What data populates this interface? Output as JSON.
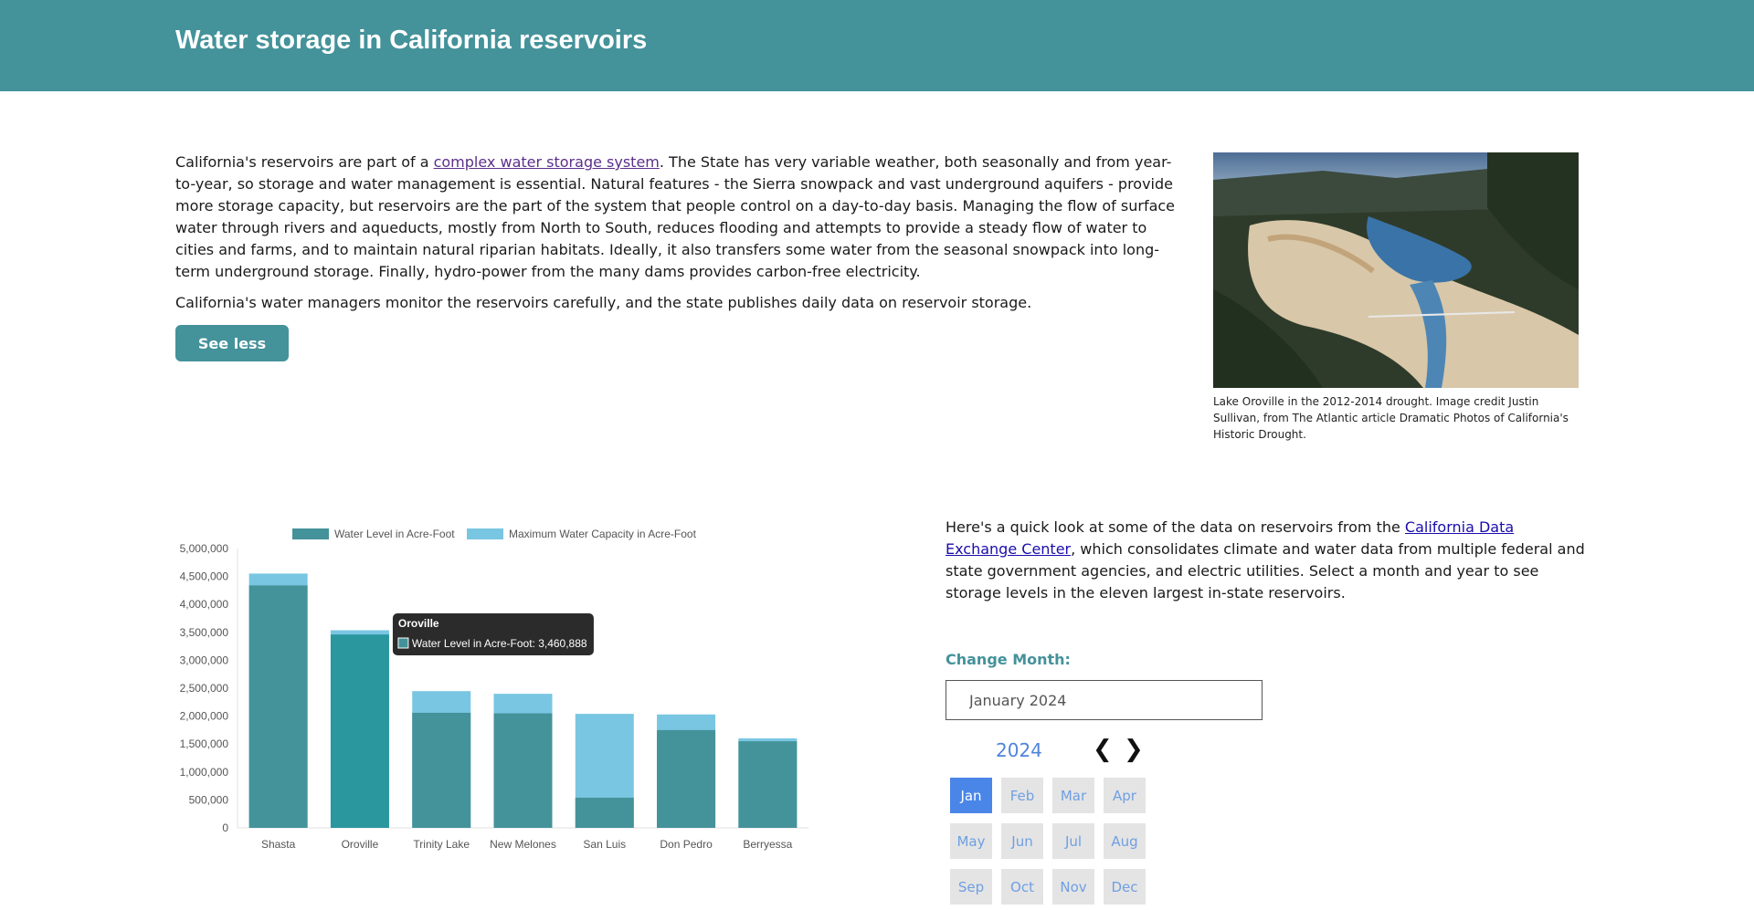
{
  "header": {
    "title": "Water storage in California reservoirs"
  },
  "intro": {
    "p1_before": "California's reservoirs are part of a ",
    "p1_link": "complex water storage system",
    "p1_after": ". The State has very variable weather, both seasonally and from year-to-year, so storage and water management is essential. Natural features - the Sierra snowpack and vast underground aquifers - provide more storage capacity, but reservoirs are the part of the system that people control on a day-to-day basis. Managing the flow of surface water through rivers and aqueducts, mostly from North to South, reduces flooding and attempts to provide a steady flow of water to cities and farms, and to maintain natural riparian habitats. Ideally, it also transfers some water from the seasonal snowpack into long-term underground storage. Finally, hydro-power from the many dams provides carbon-free electricity.",
    "p2": "California's water managers monitor the reservoirs carefully, and the state publishes daily data on reservoir storage.",
    "button_label": "See less"
  },
  "photo": {
    "caption": "Lake Oroville in the 2012-2014 drought. Image credit Justin Sullivan, from The Atlantic article Dramatic Photos of California's Historic Drought."
  },
  "right": {
    "p_before": "Here's a quick look at some of the data on reservoirs from the ",
    "p_link": "California Data Exchange Center",
    "p_after": ", which consolidates climate and water data from multiple federal and state government agencies, and electric utilities. Select a month and year to see storage levels in the eleven largest in-state reservoirs.",
    "change_month_label": "Change Month:",
    "month_value": "January 2024",
    "year": "2024",
    "prev_icon": "❮",
    "next_icon": "❯",
    "months": [
      "Jan",
      "Feb",
      "Mar",
      "Apr",
      "May",
      "Jun",
      "Jul",
      "Aug",
      "Sep",
      "Oct",
      "Nov",
      "Dec"
    ],
    "active_month": "Jan"
  },
  "chart_data": {
    "type": "bar",
    "categories": [
      "Shasta",
      "Oroville",
      "Trinity Lake",
      "New Melones",
      "San Luis",
      "Don Pedro",
      "Berryessa"
    ],
    "series": [
      {
        "name": "Water Level in Acre-Foot",
        "color": "#44929a",
        "values": [
          4340000,
          3460888,
          2060000,
          2050000,
          540000,
          1750000,
          1550000
        ]
      },
      {
        "name": "Maximum Water Capacity in Acre-Foot",
        "color": "#79c6e2",
        "values": [
          4552000,
          3537577,
          2447650,
          2400000,
          2041000,
          2030000,
          1602000
        ]
      }
    ],
    "stacked": "overlay",
    "ylim": [
      0,
      5000000
    ],
    "yticks": [
      "0",
      "500,000",
      "1,000,000",
      "1,500,000",
      "2,000,000",
      "2,500,000",
      "3,000,000",
      "3,500,000",
      "4,000,000",
      "4,500,000",
      "5,000,000"
    ],
    "legend_position": "top",
    "tooltip": {
      "title": "Oroville",
      "label": "Water Level in Acre-Foot: 3,460,888"
    },
    "highlight_color": "#2a969e"
  }
}
